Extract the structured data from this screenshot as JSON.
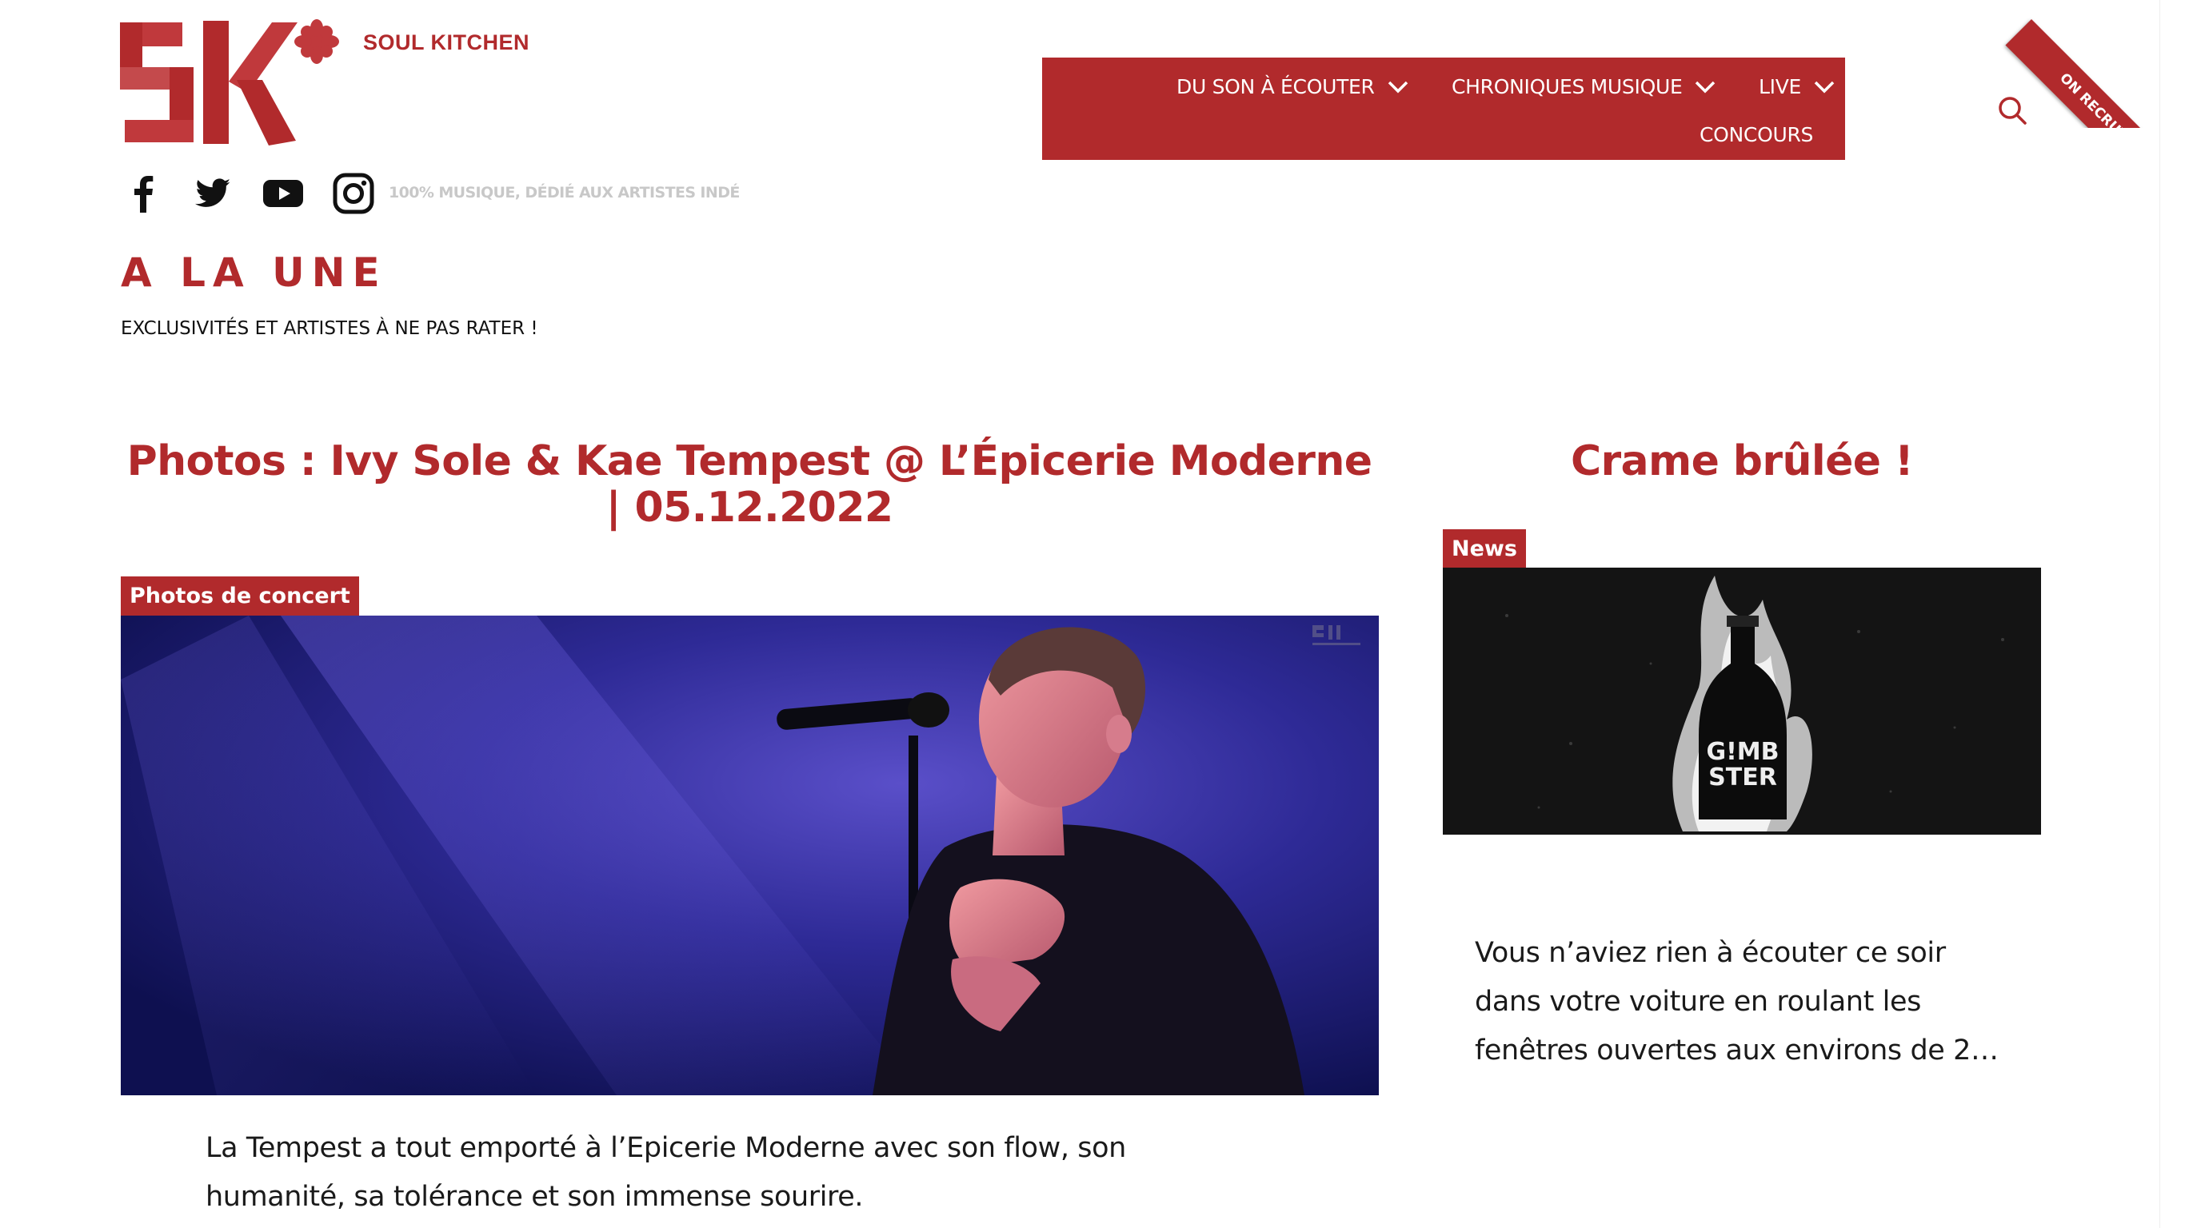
{
  "site": {
    "logo_letters": "5K",
    "name": "SOUL KITCHEN",
    "tagline": "100% MUSIQUE, DÉDIÉ AUX ARTISTES INDÉ",
    "brand_color": "#b12a2c"
  },
  "social": [
    {
      "name": "facebook-icon"
    },
    {
      "name": "twitter-icon"
    },
    {
      "name": "youtube-icon"
    },
    {
      "name": "instagram-icon"
    }
  ],
  "nav": {
    "items": [
      {
        "label": "DU SON À ÉCOUTER",
        "has_dropdown": true
      },
      {
        "label": "CHRONIQUES MUSIQUE",
        "has_dropdown": true
      },
      {
        "label": "LIVE",
        "has_dropdown": true
      },
      {
        "label": "CONCOURS",
        "has_dropdown": false
      }
    ],
    "search_icon": "search-icon"
  },
  "ribbon": {
    "label": "ON RECRUTE !"
  },
  "section": {
    "title": "A LA UNE",
    "subtitle": "EXCLUSIVITÉS ET ARTISTES À NE PAS RATER !"
  },
  "main_article": {
    "title": "Photos : Ivy Sole & Kae Tempest @ L’Épicerie Moderne | 05.12.2022",
    "category": "Photos de concert",
    "excerpt": "La Tempest a tout emporté à l’Epicerie Moderne avec son flow, son humanité, sa tolérance et son immense sourire."
  },
  "side_article": {
    "title": "Crame brûlée !",
    "category": "News",
    "excerpt": "Vous n’aviez rien à écouter ce soir dans votre voiture en roulant les fenêtres ouvertes aux environs de 2…"
  }
}
